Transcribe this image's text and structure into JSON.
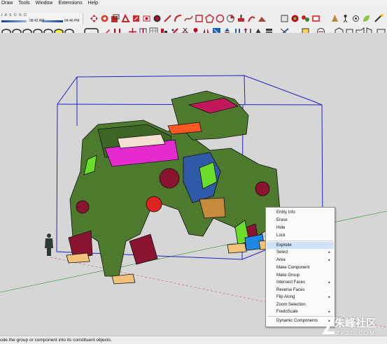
{
  "menu": [
    "Draw",
    "Tools",
    "Window",
    "Extensions",
    "Help"
  ],
  "shadow_settings": {
    "months": "J A S O N D",
    "time_start": "08:42 AM",
    "time_end": "04:46 PM"
  },
  "context_menu": {
    "items": [
      {
        "label": "Entity Info",
        "submenu": false
      },
      {
        "label": "Erase",
        "submenu": false
      },
      {
        "label": "Hide",
        "submenu": false
      },
      {
        "label": "Lock",
        "submenu": false
      },
      {
        "label": "Explode",
        "submenu": false,
        "highlighted": true
      },
      {
        "label": "Select",
        "submenu": true
      },
      {
        "label": "Area",
        "submenu": true
      },
      {
        "label": "Make Component",
        "submenu": false
      },
      {
        "label": "Make Group",
        "submenu": false
      },
      {
        "label": "Intersect Faces",
        "submenu": true
      },
      {
        "label": "Reverse Faces",
        "submenu": false
      },
      {
        "label": "Flip Along",
        "submenu": true
      },
      {
        "label": "Zoom Selection",
        "submenu": false
      },
      {
        "label": "FredoScale",
        "submenu": true
      },
      {
        "label": "Dynamic Components",
        "submenu": true
      }
    ],
    "submenu_arrow": "▸"
  },
  "status_bar": {
    "text": "ode the group or component into its constituent objects."
  },
  "watermark": {
    "text": "朱峰社区",
    "sub": "ZF3D.COM"
  },
  "colors": {
    "selection_box": "#2020c8",
    "robot_body": "#4e7a2e",
    "robot_accent": "#e52ad0",
    "robot_dark": "#8a1430",
    "highlight": "#cfe2f7"
  }
}
